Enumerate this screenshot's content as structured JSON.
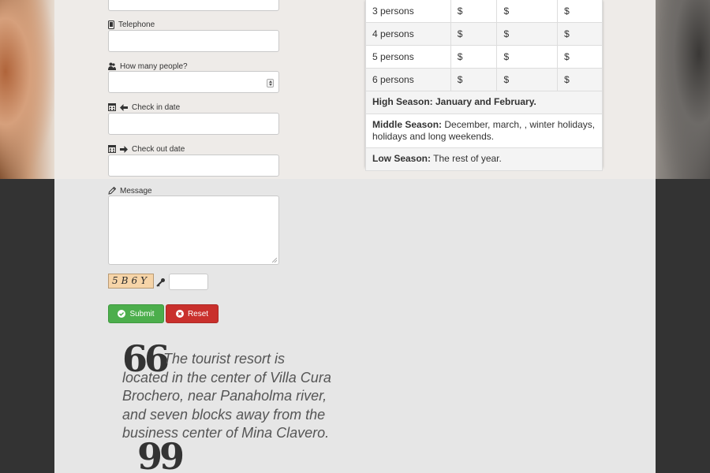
{
  "form": {
    "telephone_label": "Telephone",
    "people_label": "How many people?",
    "checkin_label": "Check in date",
    "checkout_label": "Check out date",
    "message_label": "Message",
    "captcha_text": "5B6Y",
    "submit_label": "Submit",
    "reset_label": "Reset"
  },
  "prices": {
    "rows": [
      {
        "persons": "3 persons",
        "p1": "$",
        "p2": "$",
        "p3": "$"
      },
      {
        "persons": "4 persons",
        "p1": "$",
        "p2": "$",
        "p3": "$"
      },
      {
        "persons": "5 persons",
        "p1": "$",
        "p2": "$",
        "p3": "$"
      },
      {
        "persons": "6 persons",
        "p1": "$",
        "p2": "$",
        "p3": "$"
      }
    ],
    "high_season": "High Season: January and February.",
    "middle_label": "Middle Season:",
    "middle_text": " December, march, , winter holidays, holidays and long weekends.",
    "low_label": "Low Season:",
    "low_text": " The rest of year."
  },
  "quote": {
    "open_mark": "66",
    "text": "The tourist resort is located in the center of Villa Cura Brochero, near Panaholma river, and seven blocks away from the business center of Mina Clavero.",
    "close_mark": "99"
  },
  "colors": {
    "submit": "#4cae4c",
    "reset": "#c9302c",
    "page_dark": "#333333",
    "panel": "#e6e6e6"
  },
  "icons": [
    "phone-icon",
    "people-icon",
    "calendar-checkin-icon",
    "arrow-left-icon",
    "calendar-checkout-icon",
    "arrow-right-icon",
    "pencil-icon",
    "key-icon",
    "check-circle-icon",
    "close-circle-icon"
  ]
}
